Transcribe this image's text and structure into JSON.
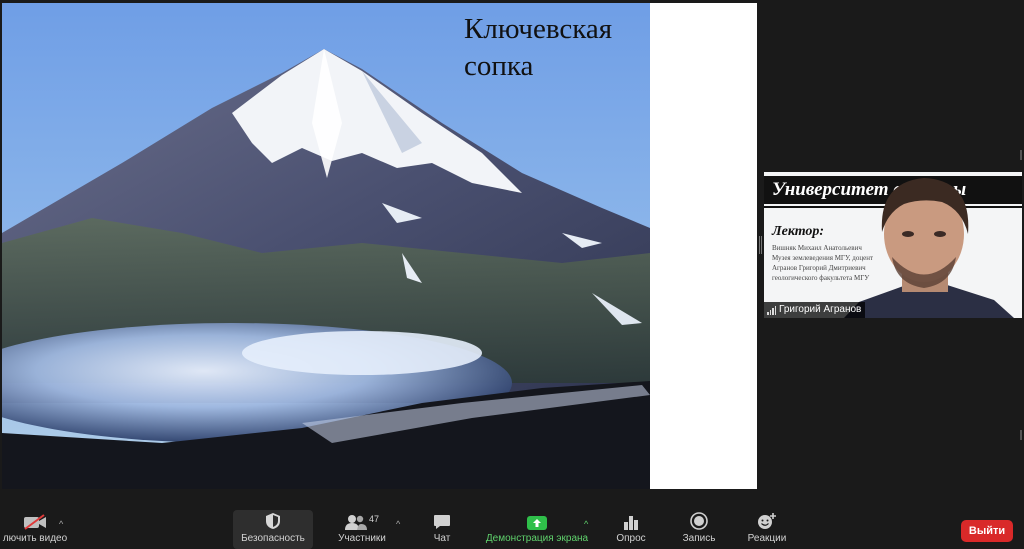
{
  "slide": {
    "title": "Ключевская\nсопка"
  },
  "participant_tile": {
    "banner_text": "Университет субботы",
    "lecturer_label": "Лектор:",
    "detail_lines": [
      "Вишняк Михаил Анатольевич",
      "Музея землеведения МГУ, доцент",
      "Агранов Григорий Дмитриевич",
      "геологического факультета МГУ"
    ],
    "name": "Григорий Агранов"
  },
  "toolbar": {
    "video_label": "лючить видео",
    "security_label": "Безопасность",
    "participants_label": "Участники",
    "participants_count": "47",
    "chat_label": "Чат",
    "share_label": "Демонстрация экрана",
    "poll_label": "Опрос",
    "record_label": "Запись",
    "reactions_label": "Реакции",
    "leave_label": "Выйти"
  },
  "colors": {
    "leave": "#d92929",
    "share_accent": "#2fbf4a",
    "toolbar_bg": "#1a1a1a"
  }
}
